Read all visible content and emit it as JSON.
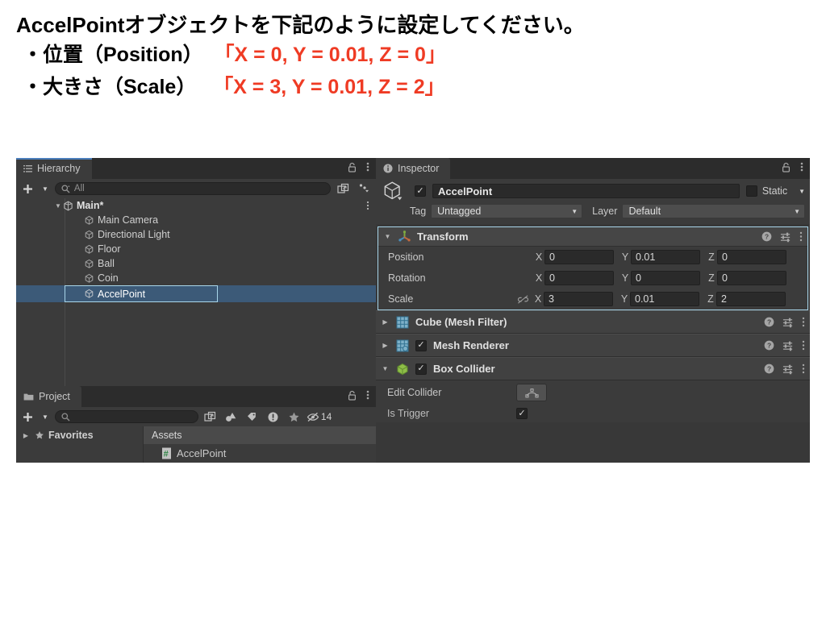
{
  "header": {
    "line1": "AccelPointオブジェクトを下記のように設定してください。",
    "line2_black": "・位置（Position）",
    "line2_red": "「X = 0, Y = 0.01, Z = 0」",
    "line3_black": "・大きさ（Scale）",
    "line3_red": "「X = 3, Y = 0.01, Z = 2」",
    "accent_color": "#ef3b24"
  },
  "hierarchy": {
    "tab_label": "Hierarchy",
    "tab_icon": "list-icon",
    "lock_icon": "lock-icon",
    "menu_icon": "kebab-menu-icon",
    "add_label": "+",
    "search_placeholder": "All",
    "search_icon": "search-icon",
    "save_search_icon": "save-search-icon",
    "sort_icon": "sort-icon",
    "items": [
      {
        "label": "Main*",
        "depth": 0,
        "expanded": true,
        "icon": "unity-scene-icon",
        "selected": false,
        "kebab": true
      },
      {
        "label": "Main Camera",
        "depth": 1,
        "icon": "gameobject-cube-icon",
        "selected": false
      },
      {
        "label": "Directional Light",
        "depth": 1,
        "icon": "gameobject-cube-icon",
        "selected": false
      },
      {
        "label": "Floor",
        "depth": 1,
        "icon": "gameobject-cube-icon",
        "selected": false
      },
      {
        "label": "Ball",
        "depth": 1,
        "icon": "gameobject-cube-icon",
        "selected": false
      },
      {
        "label": "Coin",
        "depth": 1,
        "icon": "gameobject-cube-icon",
        "selected": false
      },
      {
        "label": "AccelPoint",
        "depth": 1,
        "icon": "gameobject-cube-icon",
        "selected": true
      }
    ],
    "selection_outline_color": "#a9d6ea",
    "selection_bg_color": "#3c5a78"
  },
  "project": {
    "tab_label": "Project",
    "tab_icon": "folder-icon",
    "lock_icon": "lock-icon",
    "menu_icon": "kebab-menu-icon",
    "add_label": "+",
    "search_placeholder": "",
    "search_icon": "search-icon",
    "toolbar_icons": [
      "save-search-icon",
      "type-filter-icon",
      "label-filter-icon",
      "warning-filter-icon",
      "favorite-star-icon",
      "hidden-eye-icon"
    ],
    "hidden_count": "14",
    "tree": [
      {
        "label": "Favorites",
        "icon": "star-icon",
        "expanded": false
      }
    ],
    "assets_header": "Assets",
    "assets": [
      {
        "label": "AccelPoint",
        "icon": "csharp-script-icon"
      }
    ]
  },
  "inspector": {
    "tab_label": "Inspector",
    "tab_icon": "info-icon",
    "lock_icon": "lock-icon",
    "menu_icon": "kebab-menu-icon",
    "object_icon": "gameobject-cube-icon",
    "enabled": true,
    "object_name": "AccelPoint",
    "static_label": "Static",
    "static_checked": false,
    "tag_label": "Tag",
    "tag_value": "Untagged",
    "layer_label": "Layer",
    "layer_value": "Default",
    "transform": {
      "title": "Transform",
      "icon": "transform-gizmo-icon",
      "expanded": true,
      "highlight_color": "#a9d6ea",
      "help_icon": "help-icon",
      "preset_icon": "preset-settings-icon",
      "menu_icon": "kebab-menu-icon",
      "rows": [
        {
          "label": "Position",
          "x": "0",
          "y": "0.01",
          "z": "0",
          "link_icon": false
        },
        {
          "label": "Rotation",
          "x": "0",
          "y": "0",
          "z": "0",
          "link_icon": false
        },
        {
          "label": "Scale",
          "x": "3",
          "y": "0.01",
          "z": "2",
          "link_icon": true
        }
      ],
      "axis_labels": {
        "x": "X",
        "y": "Y",
        "z": "Z"
      }
    },
    "components": [
      {
        "title": "Cube (Mesh Filter)",
        "icon": "mesh-filter-icon",
        "expanded": false,
        "has_checkbox": false,
        "checked": false,
        "help_icon": "help-icon",
        "preset_icon": "preset-settings-icon",
        "menu_icon": "kebab-menu-icon"
      },
      {
        "title": "Mesh Renderer",
        "icon": "mesh-renderer-icon",
        "expanded": false,
        "has_checkbox": true,
        "checked": true,
        "help_icon": "help-icon",
        "preset_icon": "preset-settings-icon",
        "menu_icon": "kebab-menu-icon"
      },
      {
        "title": "Box Collider",
        "icon": "box-collider-icon",
        "expanded": true,
        "has_checkbox": true,
        "checked": true,
        "help_icon": "help-icon",
        "preset_icon": "preset-settings-icon",
        "menu_icon": "kebab-menu-icon"
      }
    ],
    "box_collider_props": {
      "edit_collider_label": "Edit Collider",
      "edit_collider_icon": "edit-collider-icon",
      "is_trigger_label": "Is Trigger",
      "is_trigger_checked": true
    }
  }
}
